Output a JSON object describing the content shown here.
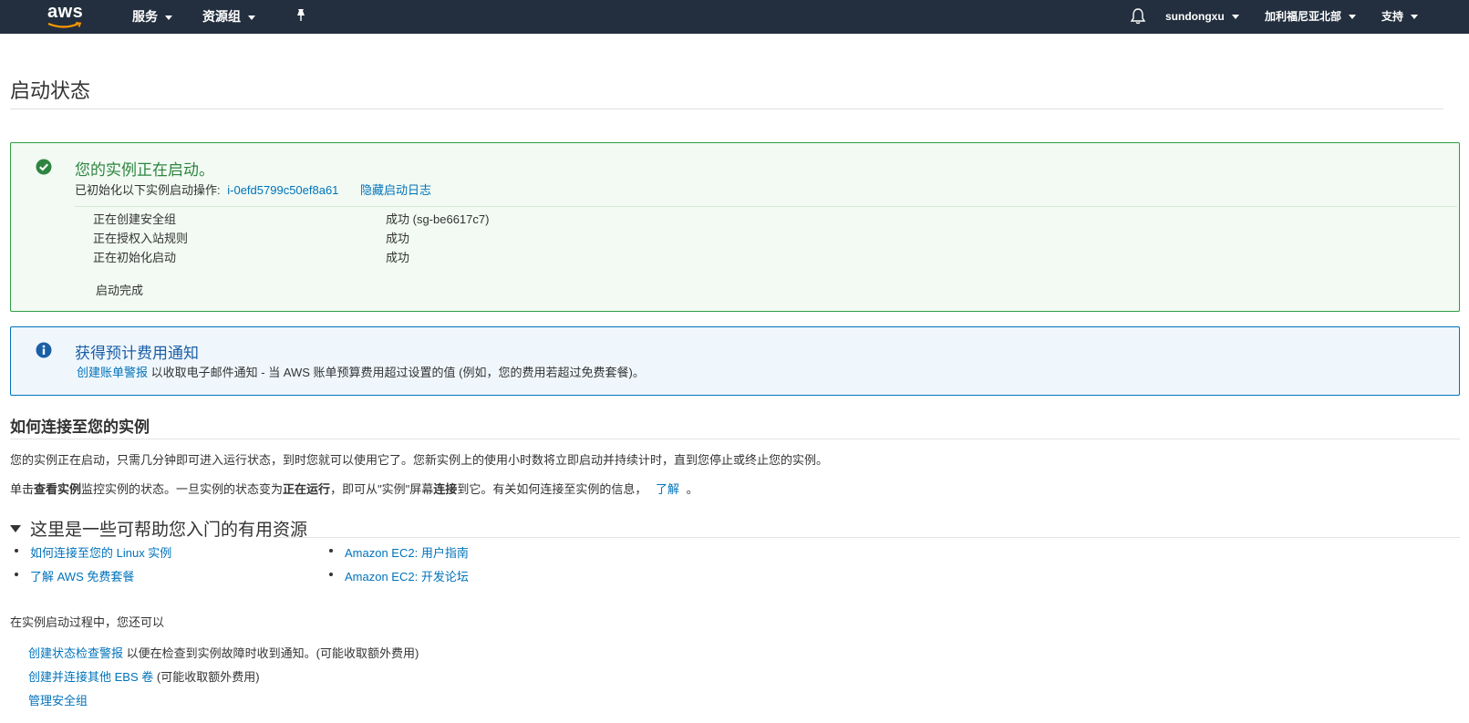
{
  "nav": {
    "logo": "aws",
    "services": "服务",
    "resource_groups": "资源组",
    "user": "sundongxu",
    "region": "加利福尼亚北部",
    "support": "支持"
  },
  "page": {
    "title": "启动状态"
  },
  "success": {
    "title": "您的实例正在启动。",
    "sub_prefix": "已初始化以下实例启动操作:",
    "instance_id": "i-0efd5799c50ef8a61",
    "hide_log": "隐藏启动日志",
    "log": [
      {
        "step": "正在创建安全组",
        "result": "成功 (sg-be6617c7)"
      },
      {
        "step": "正在授权入站规则",
        "result": "成功"
      },
      {
        "step": "正在初始化启动",
        "result": "成功"
      }
    ],
    "done": "启动完成"
  },
  "billing": {
    "title": "获得预计费用通知",
    "link": "创建账单警报",
    "text": "以收取电子邮件通知 - 当 AWS 账单预算费用超过设置的值 (例如，您的费用若超过免费套餐)。"
  },
  "connect": {
    "heading": "如何连接至您的实例",
    "para1": "您的实例正在启动，只需几分钟即可进入运行状态，到时您就可以使用它了。您新实例上的使用小时数将立即启动并持续计时，直到您停止或终止您的实例。",
    "para2_a": "单击",
    "para2_b": "查看实例",
    "para2_c": "监控实例的状态。一旦实例的状态变为",
    "para2_d": "正在运行",
    "para2_e": "，即可从\"实例\"屏幕",
    "para2_f": "连接",
    "para2_g": "到它。有关如何连接至实例的信息，",
    "learn": "了解",
    "para2_end": "。"
  },
  "resources": {
    "heading": "这里是一些可帮助您入门的有用资源",
    "left": [
      "如何连接至您的 Linux 实例",
      "了解 AWS 免费套餐"
    ],
    "right": [
      "Amazon EC2: 用户指南",
      "Amazon EC2: 开发论坛"
    ]
  },
  "also": {
    "heading": "在实例启动过程中，您还可以",
    "items": [
      {
        "link": "创建状态检查警报",
        "text": "以便在检查到实例故障时收到通知。(可能收取额外费用)"
      },
      {
        "link": "创建并连接其他 EBS 卷",
        "text": "(可能收取额外费用)"
      },
      {
        "link": "管理安全组",
        "text": ""
      }
    ]
  }
}
